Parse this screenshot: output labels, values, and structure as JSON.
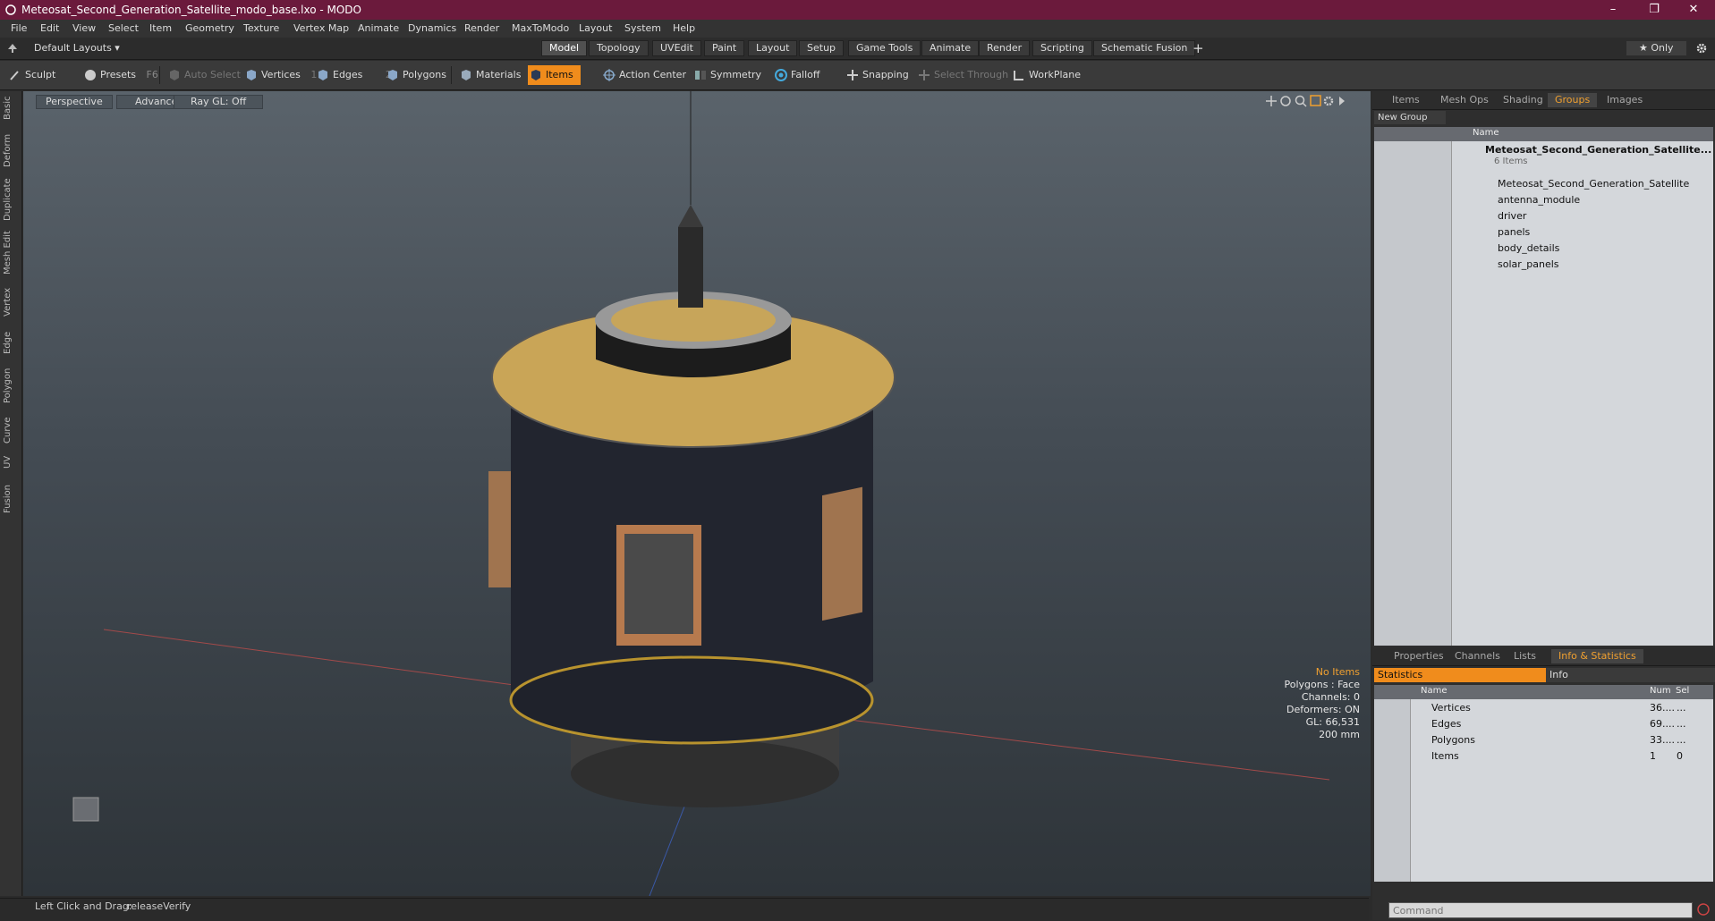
{
  "window": {
    "title": "Meteosat_Second_Generation_Satellite_modo_base.lxo - MODO",
    "minimize": "–",
    "restore": "❐",
    "close": "✕"
  },
  "menu": [
    "File",
    "Edit",
    "View",
    "Select",
    "Item",
    "Geometry",
    "Texture",
    "Vertex Map",
    "Animate",
    "Dynamics",
    "Render",
    "MaxToModo",
    "Layout",
    "System",
    "Help"
  ],
  "layout": {
    "selector": "Default Layouts ▾",
    "only": "★ Only",
    "plus": "+",
    "tabs": [
      "Model",
      "Topology",
      "UVEdit",
      "Paint",
      "Layout",
      "Setup",
      "Game Tools",
      "Animate",
      "Render",
      "Scripting",
      "Schematic Fusion"
    ]
  },
  "toolbar": {
    "sculpt": "Sculpt",
    "presets": "Presets",
    "presets_key": "F6",
    "auto_select": "Auto Select",
    "vertices": "Vertices",
    "vertices_n": "1",
    "edges": "Edges",
    "edges_n": "2",
    "polygons": "Polygons",
    "materials": "Materials",
    "items": "Items",
    "action_center": "Action Center",
    "symmetry": "Symmetry",
    "falloff": "Falloff",
    "snapping": "Snapping",
    "select_through": "Select Through",
    "workplane": "WorkPlane"
  },
  "left_tabs": [
    "Basic",
    "Deform",
    "Duplicate",
    "Mesh Edit",
    "Vertex",
    "Edge",
    "Polygon",
    "Curve",
    "UV",
    "Fusion"
  ],
  "viewport": {
    "view": "Perspective",
    "shading": "Advanced",
    "raygl": "Ray GL: Off",
    "stats": [
      "No Items",
      "Polygons : Face",
      "Channels: 0",
      "Deformers: ON",
      "GL: 66,531",
      "200 mm"
    ]
  },
  "status": {
    "hint": "Left Click and Drag:",
    "action": "releaseVerify"
  },
  "groups_panel": {
    "tabs": [
      "Items",
      "Mesh Ops",
      "Shading",
      "Groups",
      "Images"
    ],
    "new_group": "New Group",
    "col_name": "Name",
    "root": "Meteosat_Second_Generation_Satellite...",
    "root_count": "6 Items",
    "children": [
      "Meteosat_Second_Generation_Satellite",
      "antenna_module",
      "driver",
      "panels",
      "body_details",
      "solar_panels"
    ]
  },
  "stats_panel": {
    "tabs": [
      "Properties",
      "Channels",
      "Lists",
      "Info & Statistics"
    ],
    "statistics": "Statistics",
    "info": "Info",
    "cols": {
      "name": "Name",
      "num": "Num",
      "sel": "Sel"
    },
    "rows": [
      {
        "name": "Vertices",
        "num": "36....",
        "sel": "..."
      },
      {
        "name": "Edges",
        "num": "69....",
        "sel": "..."
      },
      {
        "name": "Polygons",
        "num": "33....",
        "sel": "..."
      },
      {
        "name": "Items",
        "num": "1",
        "sel": "0"
      }
    ]
  },
  "command": {
    "placeholder": "Command"
  },
  "colors": {
    "titlebar": "#6b1a3c",
    "accent": "#f08c1c"
  }
}
